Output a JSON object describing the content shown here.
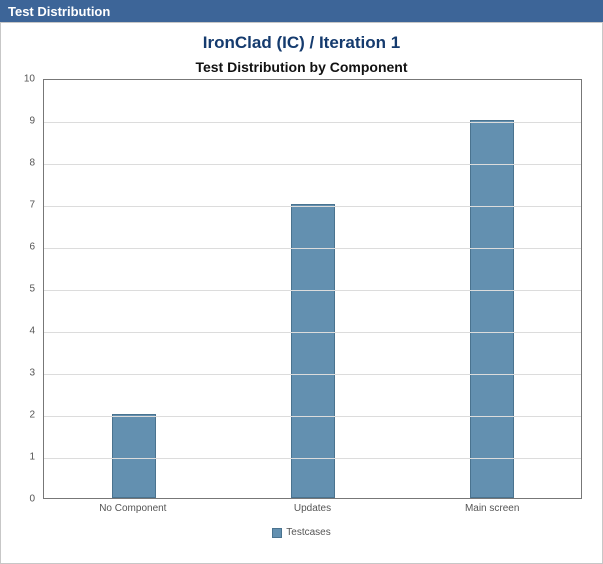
{
  "header": {
    "title": "Test Distribution"
  },
  "page_title": "IronClad (IC) / Iteration 1",
  "chart_title": "Test Distribution by Component",
  "legend": {
    "series_name": "Testcases"
  },
  "chart_data": {
    "type": "bar",
    "categories": [
      "No Component",
      "Updates",
      "Main screen"
    ],
    "values": [
      2,
      7,
      9
    ],
    "title": "Test Distribution by Component",
    "xlabel": "",
    "ylabel": "",
    "ylim": [
      0,
      10
    ],
    "yticks": [
      0,
      1,
      2,
      3,
      4,
      5,
      6,
      7,
      8,
      9,
      10
    ],
    "series": [
      {
        "name": "Testcases",
        "values": [
          2,
          7,
          9
        ]
      }
    ],
    "colors": {
      "bar_fill": "#6390b0",
      "bar_border": "#4a738f"
    }
  }
}
